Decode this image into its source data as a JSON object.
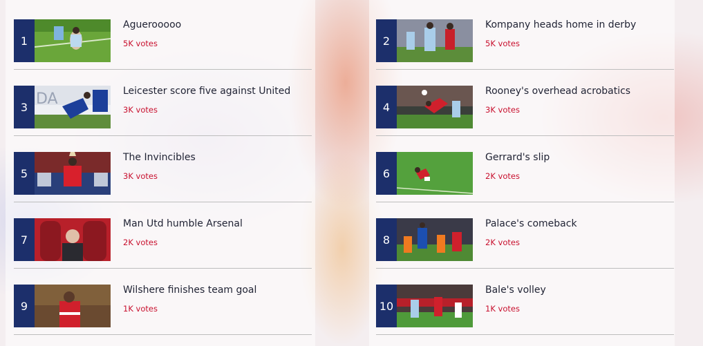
{
  "items": [
    {
      "rank": "1",
      "title": "Aguerooooo",
      "votes": "5K votes"
    },
    {
      "rank": "2",
      "title": "Kompany heads home in derby",
      "votes": "5K votes"
    },
    {
      "rank": "3",
      "title": "Leicester score five against United",
      "votes": "3K votes"
    },
    {
      "rank": "4",
      "title": "Rooney's overhead acrobatics",
      "votes": "3K votes"
    },
    {
      "rank": "5",
      "title": "The Invincibles",
      "votes": "3K votes"
    },
    {
      "rank": "6",
      "title": "Gerrard's slip",
      "votes": "2K votes"
    },
    {
      "rank": "7",
      "title": "Man Utd humble Arsenal",
      "votes": "2K votes"
    },
    {
      "rank": "8",
      "title": "Palace's comeback",
      "votes": "2K votes"
    },
    {
      "rank": "9",
      "title": "Wilshere finishes team goal",
      "votes": "1K votes"
    },
    {
      "rank": "10",
      "title": "Bale's volley",
      "votes": "1K votes"
    }
  ],
  "colors": {
    "rank_bg": "#1c2f6b",
    "votes": "#c8102e",
    "title": "#1f2233"
  }
}
